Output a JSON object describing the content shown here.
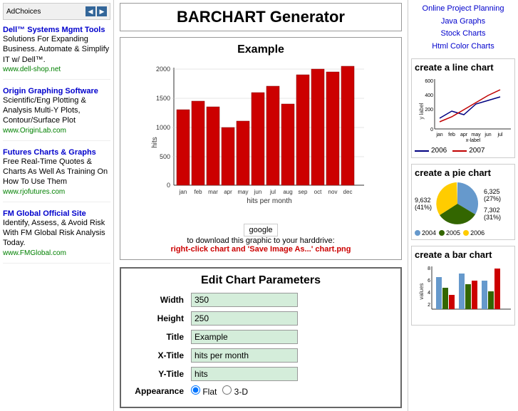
{
  "page": {
    "title": "BARCHART Generator"
  },
  "left_sidebar": {
    "ad_choices_label": "AdChoices",
    "ads": [
      {
        "id": "ad1",
        "title": "Dell™ Systems Mgmt Tools",
        "url_text": "www.dell-shop.net",
        "body": "Solutions For Expanding Business. Automate & Simplify IT w/ Dell™."
      },
      {
        "id": "ad2",
        "title": "Origin Graphing Software",
        "url_text": "www.OriginLab.com",
        "body": "Scientific/Eng Plotting & Analysis Multi-Y Plots, Contour/Surface Plot"
      },
      {
        "id": "ad3",
        "title": "Futures Charts & Graphs",
        "url_text": "www.rjofutures.com",
        "body": "Free Real-Time Quotes & Charts As Well As Training On How To Use Them"
      },
      {
        "id": "ad4",
        "title": "FM Global Official Site",
        "url_text": "www.FMGlobal.com",
        "body": "Identify, Assess, & Avoid Risk With FM Global Risk Analysis Today."
      }
    ]
  },
  "main": {
    "title": "BARCHART Generator",
    "chart": {
      "title": "Example",
      "bars": [
        {
          "label": "jan",
          "value": 1300
        },
        {
          "label": "feb",
          "value": 1450
        },
        {
          "label": "mar",
          "value": 1350
        },
        {
          "label": "apr",
          "value": 1000
        },
        {
          "label": "may",
          "value": 1100
        },
        {
          "label": "jun",
          "value": 1600
        },
        {
          "label": "jul",
          "value": 1700
        },
        {
          "label": "aug",
          "value": 1400
        },
        {
          "label": "sep",
          "value": 1900
        },
        {
          "label": "oct",
          "value": 2000
        },
        {
          "label": "nov",
          "value": 1950
        },
        {
          "label": "dec",
          "value": 2150
        }
      ],
      "y_label": "hits",
      "x_label": "hits per month",
      "y_max": 2000,
      "y_ticks": [
        0,
        500,
        1000,
        1500,
        2000
      ],
      "google_btn_label": "google",
      "download_text": "to download this graphic to your harddrive:",
      "save_instruction": "right-click chart and 'Save Image As...' chart.png"
    },
    "edit_params": {
      "title": "Edit Chart Parameters",
      "fields": [
        {
          "label": "Width",
          "value": "350"
        },
        {
          "label": "Height",
          "value": "250"
        },
        {
          "label": "Title",
          "value": "Example"
        },
        {
          "label": "X-Title",
          "value": "hits per month"
        },
        {
          "label": "Y-Title",
          "value": "hits"
        },
        {
          "label": "Appearance",
          "value": "Flat"
        }
      ],
      "appearance_options": [
        "Flat",
        "3-D"
      ]
    }
  },
  "right_sidebar": {
    "links": [
      "Online Project Planning",
      "Java Graphs",
      "Stock Charts",
      "Html Color Charts"
    ],
    "line_chart": {
      "title": "create a line chart",
      "y_label": "y label",
      "x_label": "x-label",
      "legend": [
        {
          "label": "2006",
          "color": "#000080"
        },
        {
          "label": "2007",
          "color": "#c00000"
        }
      ]
    },
    "pie_chart": {
      "title": "create a pie chart",
      "slices": [
        {
          "label": "2004",
          "value": 9632,
          "pct": 41,
          "color": "#6699cc"
        },
        {
          "label": "2005",
          "value": 7302,
          "pct": 31,
          "color": "#336600"
        },
        {
          "label": "2006",
          "value": 6325,
          "pct": 27,
          "color": "#ffcc00"
        }
      ]
    },
    "bar_chart": {
      "title": "create a bar chart"
    }
  }
}
